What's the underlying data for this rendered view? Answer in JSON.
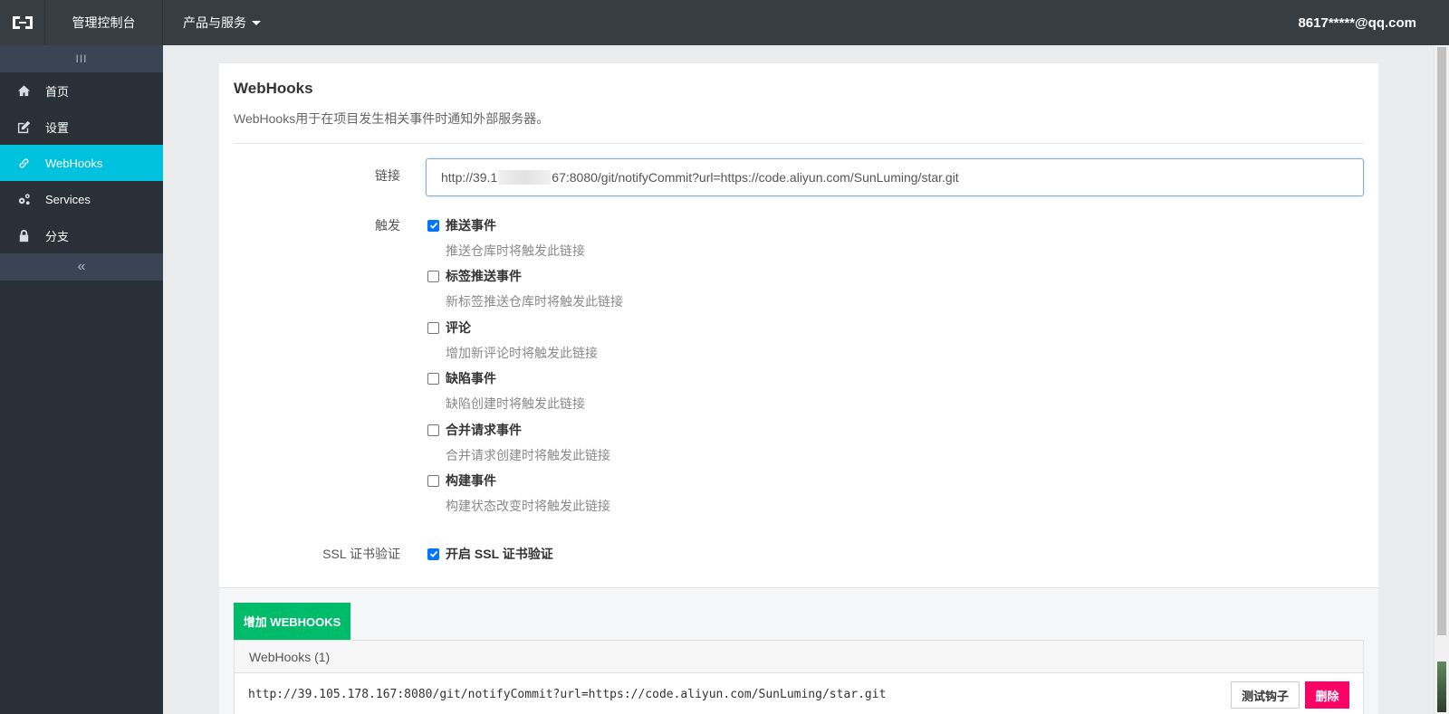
{
  "header": {
    "console_title": "管理控制台",
    "products_label": "产品与服务",
    "user_email": "8617*****@qq.com"
  },
  "sidebar": {
    "toggle_glyph": "III",
    "collapse_glyph": "«",
    "items": [
      {
        "label": "首页",
        "icon": "home-icon"
      },
      {
        "label": "设置",
        "icon": "edit-icon"
      },
      {
        "label": "WebHooks",
        "icon": "link-icon"
      },
      {
        "label": "Services",
        "icon": "gears-icon"
      },
      {
        "label": "分支",
        "icon": "lock-icon"
      }
    ],
    "active_color": "#00c1de"
  },
  "panel": {
    "title": "WebHooks",
    "desc_prefix": "WebHooks",
    "desc_rest": "用于在项目发生相关事件时通知外部服务器。",
    "url_label": "链接",
    "url_value_start": "http://39.1",
    "url_value_end": "67:8080/git/notifyCommit?url=https://code.aliyun.com/SunLuming/star.git",
    "trigger_label": "触发",
    "triggers": [
      {
        "title": "推送事件",
        "hint": "推送仓库时将触发此链接",
        "checked": true
      },
      {
        "title": "标签推送事件",
        "hint": "新标签推送仓库时将触发此链接",
        "checked": false
      },
      {
        "title": "评论",
        "hint": "增加新评论时将触发此链接",
        "checked": false
      },
      {
        "title": "缺陷事件",
        "hint": "缺陷创建时将触发此链接",
        "checked": false
      },
      {
        "title": "合并请求事件",
        "hint": "合并请求创建时将触发此链接",
        "checked": false
      },
      {
        "title": "构建事件",
        "hint": "构建状态改变时将触发此链接",
        "checked": false
      }
    ],
    "ssl_label": "SSL 证书验证",
    "ssl_option": "开启 SSL 证书验证",
    "ssl_checked": true
  },
  "hooks": {
    "add_button": "增加 WEBHOOKS",
    "list_title": "WebHooks (1)",
    "rows": [
      {
        "url": "http://39.105.178.167:8080/git/notifyCommit?url=https://code.aliyun.com/SunLuming/star.git"
      }
    ],
    "test_button": "测试钩子",
    "delete_button": "删除"
  }
}
